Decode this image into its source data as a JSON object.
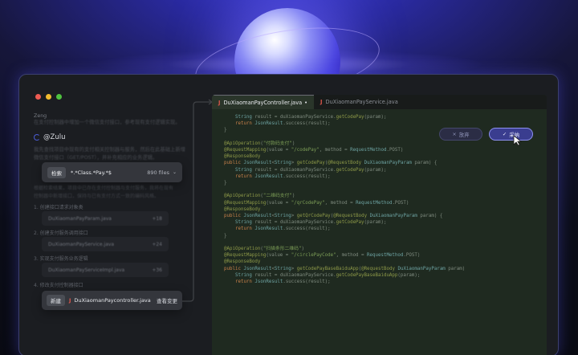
{
  "window": {
    "controls": [
      "close",
      "minimize",
      "maximize"
    ]
  },
  "chat": {
    "user_name": "Zeng",
    "user_message_lines": [
      "在支付控制器中增加一个微信支付接口，参考现有支付逻辑实现。"
    ],
    "assistant_name": "@Zulu",
    "assistant_intro_lines": [
      "我先查找项目中现有的支付相关控制器与服务，然后在此基础上新增",
      "微信支付接口（GET/POST），并补充相应的业务逻辑。"
    ],
    "search": {
      "chip": "检索",
      "pattern": "*.*Class.*Pay.*$",
      "count": "890 files",
      "chevron": "chevron-down-icon"
    },
    "analysis_lines": [
      "根据检索结果，项目中已存在支付控制器与支付服务，我将在现有",
      "控制器中新增接口，保持与已有支付方式一致的编码风格。"
    ],
    "steps": [
      {
        "title": "1. 创建接口请求对象类",
        "file": "DuXiaomanPayParam.java",
        "meta": "+18"
      },
      {
        "title": "2. 创建支付服务调用接口",
        "file": "DuXiaomanPayService.java",
        "meta": "+24"
      },
      {
        "title": "3. 实现支付服务业务逻辑",
        "file": "DuXiaomanPayServiceImpl.java",
        "meta": "+36"
      }
    ],
    "step4_title": "4. 修改支付控制器接口",
    "bottom_card": {
      "chip": "新建",
      "file": "DuXiaomanPaycontroller.java",
      "action": "查看变更"
    }
  },
  "editor": {
    "tabs": [
      {
        "label": "DuXiaomanPayController.java",
        "active": true
      },
      {
        "label": "DuXiaomanPayService.java",
        "active": false
      }
    ]
  },
  "diff_actions": {
    "reject_label": "放弃",
    "accept_label": "采纳",
    "reject_icon": "close-icon",
    "accept_icon": "check-icon"
  },
  "colors": {
    "accent": "#3a3d8f",
    "accent_border": "#8d90ee",
    "background_glow": "#3f3fd9"
  }
}
